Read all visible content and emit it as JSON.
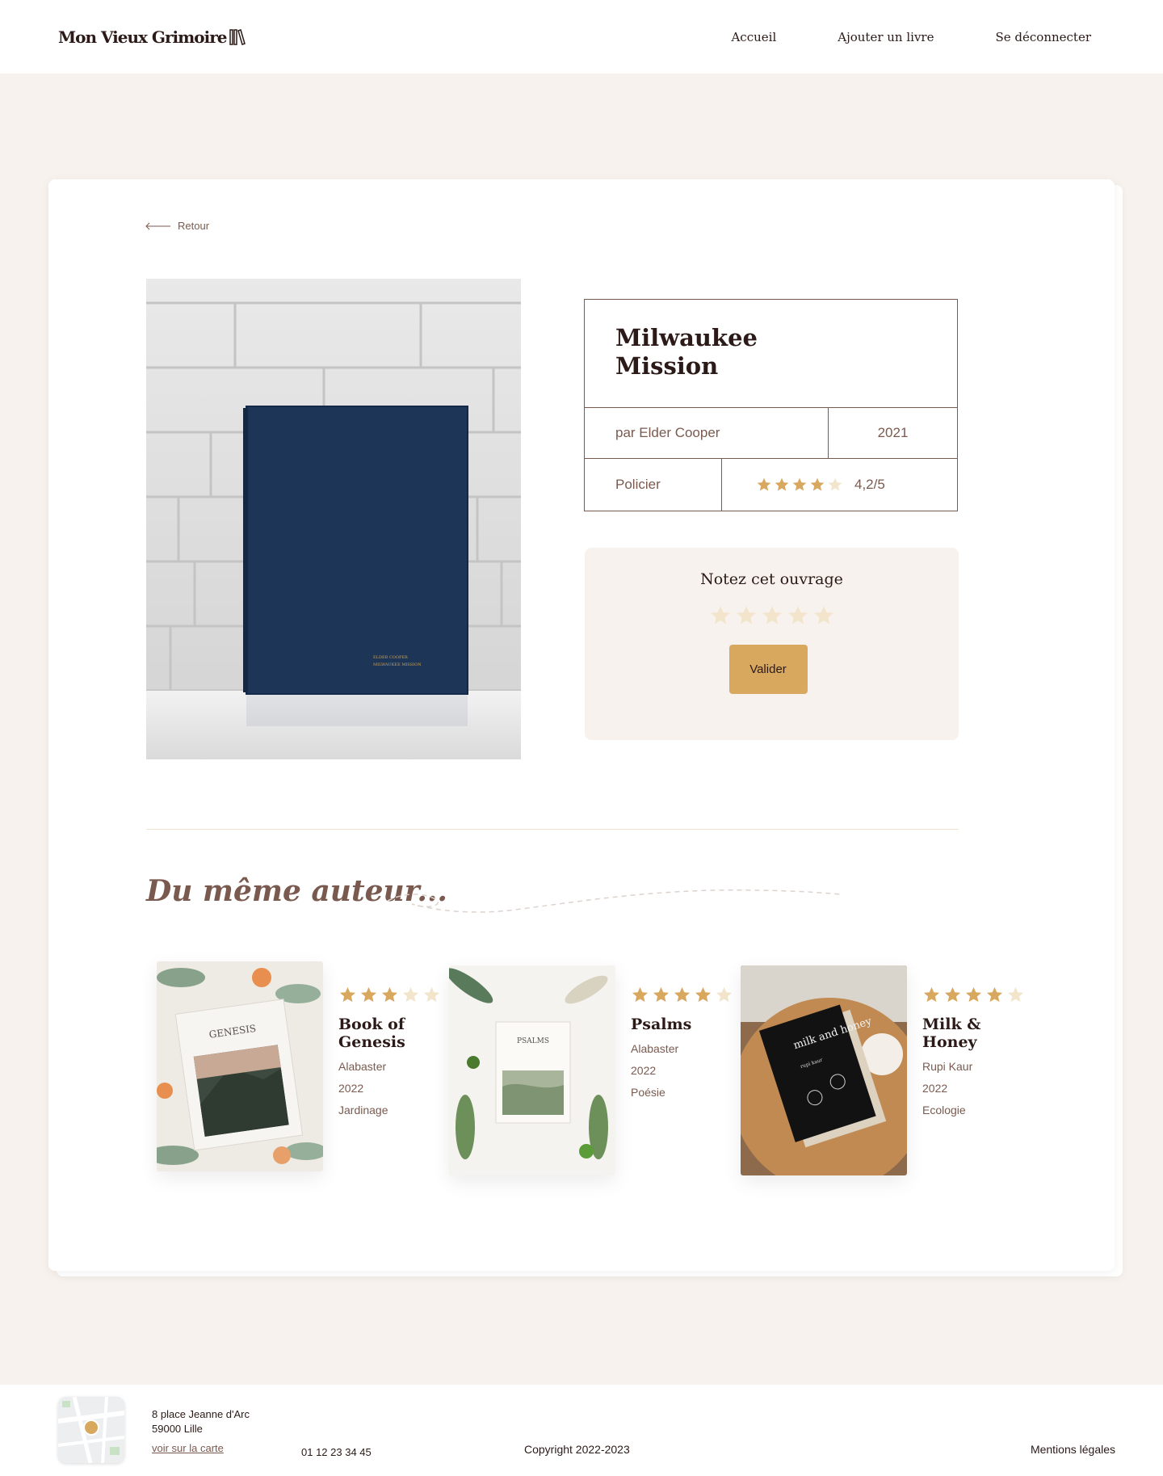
{
  "header": {
    "logo_text": "Mon Vieux Grimoire",
    "nav": [
      "Accueil",
      "Ajouter un livre",
      "Se déconnecter"
    ]
  },
  "book": {
    "back_label": "Retour",
    "title": "Milwaukee Mission",
    "author": "par Elder Cooper",
    "year": "2021",
    "genre": "Policier",
    "rating": 4.2,
    "rating_text": "4,2/5"
  },
  "rate_box": {
    "title": "Notez cet ouvrage",
    "button_label": "Valider"
  },
  "same_author": {
    "heading": "Du même auteur...",
    "books": [
      {
        "title": "Book of Genesis",
        "author": "Alabaster",
        "year": "2022",
        "genre": "Jardinage",
        "rating": 3
      },
      {
        "title": "Psalms",
        "author": "Alabaster",
        "year": "2022",
        "genre": "Poésie",
        "rating": 4
      },
      {
        "title": "Milk & Honey",
        "author": "Rupi Kaur",
        "year": "2022",
        "genre": "Ecologie",
        "rating": 4
      }
    ]
  },
  "cover_texts": {
    "genesis": "GENESIS",
    "psalms": "PSALMS",
    "milk_honey": "milk and honey",
    "milk_honey_author": "rupi kaur",
    "milwaukee_line1": "ELDER COOPER",
    "milwaukee_line2": "MILWAUKEE MISSION"
  },
  "footer": {
    "address_line1": "8 place Jeanne d'Arc",
    "address_line2": "59000 Lille",
    "map_link": "voir sur la carte",
    "phone": "01 12 23 34 45",
    "copyright": "Copyright 2022-2023",
    "legal": "Mentions légales"
  },
  "colors": {
    "accent": "#d9a85f",
    "brown": "#7a5a4f",
    "dark": "#2b1a17",
    "background": "#f7f2ed",
    "star_empty": "#f3e5cc"
  }
}
